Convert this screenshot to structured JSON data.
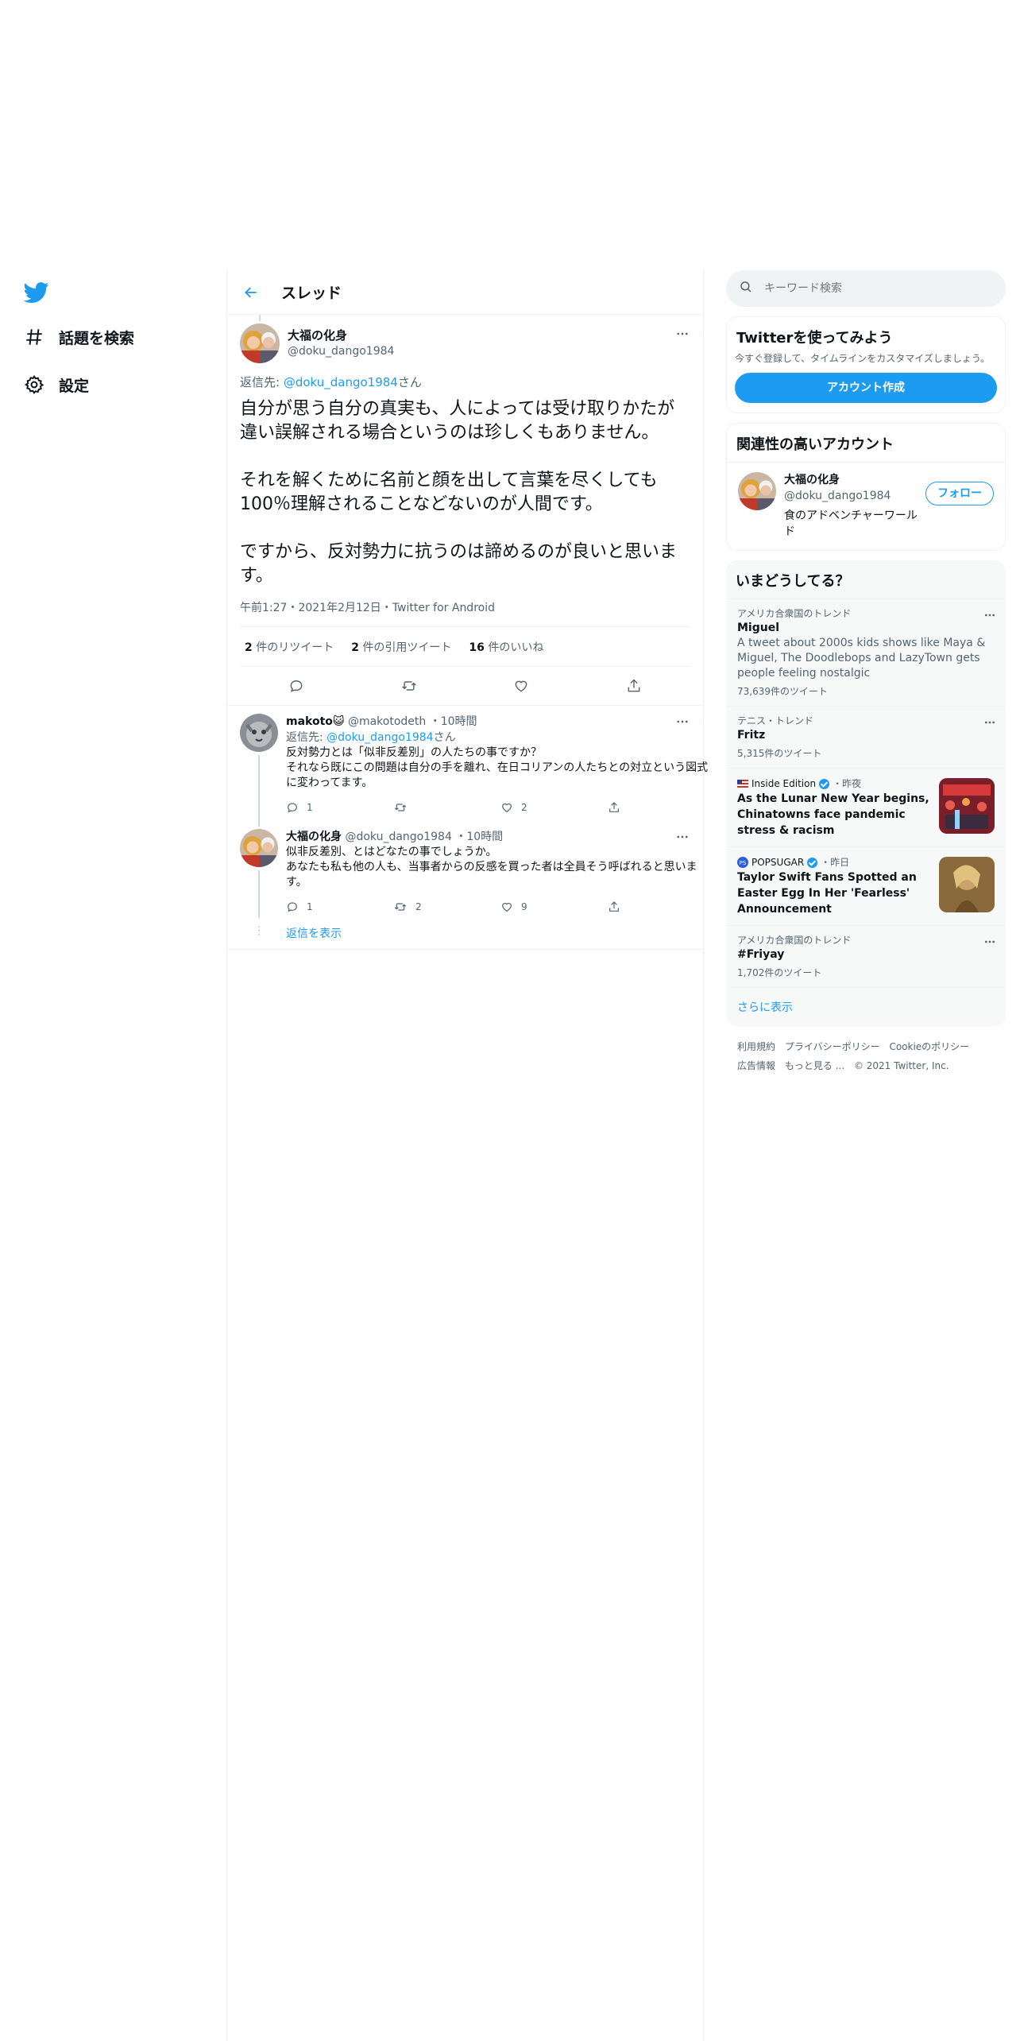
{
  "nav": {
    "items": [
      {
        "label": "話題を検索",
        "icon": "hashtag-icon"
      },
      {
        "label": "設定",
        "icon": "gear-icon"
      }
    ]
  },
  "header": {
    "title": "スレッド"
  },
  "focused_tweet": {
    "display_name": "大福の化身",
    "handle": "@doku_dango1984",
    "reply_prefix": "返信先: ",
    "reply_mention": "@doku_dango1984",
    "reply_suffix": "さん",
    "body": "自分が思う自分の真実も、人によっては受け取りかたが違い誤解される場合というのは珍しくもありません。\n\nそれを解くために名前と顔を出して言葉を尽くしても100％理解されることなどないのが人間です。\n\nですから、反対勢力に抗うのは諦めるのが良いと思います。",
    "meta": "午前1:27・2021年2月12日・Twitter for Android",
    "retweets_num": "2",
    "retweets_label": " 件のリツイート",
    "quotes_num": "2",
    "quotes_label": " 件の引用ツイート",
    "likes_num": "16",
    "likes_label": " 件のいいね"
  },
  "replies": [
    {
      "display_name": "makoto😺",
      "handle": "@makotodeth",
      "time": "・10時間",
      "reply_prefix": "返信先: ",
      "reply_mention": "@doku_dango1984",
      "reply_suffix": "さん",
      "text": "反対勢力とは「似非反差別」の人たちの事ですか？\nそれなら既にこの問題は自分の手を離れ、在日コリアンの人たちとの対立という図式に変わってます。",
      "reply_count": "1",
      "retweet_count": "",
      "like_count": "2"
    },
    {
      "display_name": "大福の化身",
      "handle": "@doku_dango1984",
      "time": "・10時間",
      "text": "似非反差別、とはどなたの事でしょうか。\nあなたも私も他の人も、当事者からの反感を買った者は全員そう呼ばれると思います。",
      "reply_count": "1",
      "retweet_count": "2",
      "like_count": "9"
    }
  ],
  "show_replies": "返信を表示",
  "search": {
    "placeholder": "キーワード検索"
  },
  "signup": {
    "title": "Twitterを使ってみよう",
    "desc": "今すぐ登録して、タイムラインをカスタマイズしましょう。",
    "button": "アカウント作成"
  },
  "relevant": {
    "title": "関連性の高いアカウント",
    "display_name": "大福の化身",
    "handle": "@doku_dango1984",
    "bio": "食のアドベンチャーワールド",
    "follow": "フォロー"
  },
  "trends": {
    "title": "いまどうしてる？",
    "items": [
      {
        "context": "アメリカ合衆国のトレンド",
        "name": "Miguel",
        "desc": "A tweet about 2000s kids shows like Maya & Miguel, The Doodlebops and LazyTown gets people feeling nostalgic",
        "count": "73,639件のツイート"
      },
      {
        "context": "テニス・トレンド",
        "name": "Fritz",
        "count": "5,315件のツイート"
      },
      {
        "source": "Inside Edition",
        "time": "・昨夜",
        "title": "As the Lunar New Year begins, Chinatowns face pandemic stress & racism"
      },
      {
        "source": "POPSUGAR",
        "time": "・昨日",
        "title": "Taylor Swift Fans Spotted an Easter Egg In Her 'Fearless' Announcement"
      },
      {
        "context": "アメリカ合衆国のトレンド",
        "name": "#Friyay",
        "count": "1,702件のツイート"
      }
    ],
    "show_more": "さらに表示"
  },
  "footer": {
    "links": [
      "利用規約",
      "プライバシーポリシー",
      "Cookieのポリシー",
      "広告情報",
      "もっと見る ..."
    ],
    "copyright": "© 2021 Twitter, Inc."
  },
  "colors": {
    "accent": "#1d9bf0",
    "text": "#0f1419",
    "muted": "#536471",
    "border": "#eff3f4"
  }
}
